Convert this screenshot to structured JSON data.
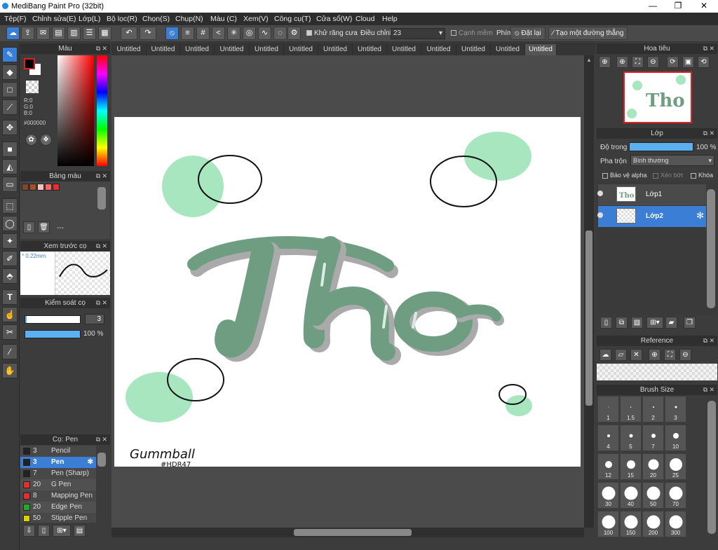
{
  "window": {
    "title": "MediBang Paint Pro (32bit)",
    "minimize": "—",
    "maximize": "❐",
    "close": "✕"
  },
  "menu": [
    "Tệp(F)",
    "Chỉnh sửa(E)",
    "Lớp(L)",
    "Bộ lọc(R)",
    "Chọn(S)",
    "Chụp(N)",
    "Màu (C)",
    "Xem(V)",
    "Công cụ(T)",
    "Cửa sổ(W)",
    "Cloud",
    "Help"
  ],
  "toolbar": {
    "antialias": "Khử răng cưa",
    "correction_label": "Điều chỉnh",
    "correction_value": "23",
    "soft_edge": "Cạnh mềm",
    "key_label": "Phím",
    "reset": "Đặt lại",
    "make_line": "Tạo một đường thẳng"
  },
  "tabs": [
    "Untitled",
    "Untitled",
    "Untitled",
    "Untitled",
    "Untitled",
    "Untitled",
    "Untitled",
    "Untitled",
    "Untitled",
    "Untitled",
    "Untitled",
    "Untitled",
    "Untitled"
  ],
  "color_panel": {
    "title": "Màu",
    "r": "R:0",
    "g": "G:0",
    "b": "B:0",
    "hex": "#000000"
  },
  "palette_panel": {
    "title": "Bảng màu",
    "dash": "---",
    "colors": [
      "#7a4a2a",
      "#a0522d",
      "#f4c2c2",
      "#ff6666",
      "#e03030"
    ]
  },
  "brush_preview": {
    "title": "Xem trước cọ",
    "size": "* 0.22mm"
  },
  "brush_control": {
    "title": "Kiểm soát cọ",
    "size_value": "3",
    "opacity_value": "100 %",
    "size_fill": 0.02,
    "opacity_fill": 1.0
  },
  "brush_list": {
    "title": "Cọ: Pen",
    "items": [
      {
        "size": "3",
        "name": "Pencil",
        "color": "#222222"
      },
      {
        "size": "3",
        "name": "Pen",
        "color": "#222222",
        "active": true
      },
      {
        "size": "7",
        "name": "Pen (Sharp)",
        "color": "#222222"
      },
      {
        "size": "20",
        "name": "G Pen",
        "color": "#e03030"
      },
      {
        "size": "8",
        "name": "Mapping Pen",
        "color": "#e03030"
      },
      {
        "size": "20",
        "name": "Edge Pen",
        "color": "#22aa22"
      },
      {
        "size": "50",
        "name": "Stipple Pen",
        "color": "#e0d000"
      }
    ]
  },
  "navigator": {
    "title": "Hoa tiêu"
  },
  "layer_panel": {
    "title": "Lớp",
    "opacity_label": "Độ trong",
    "opacity_value": "100 %",
    "opacity_fill": 1.0,
    "blend_label": "Pha trộn",
    "blend_value": "Bình thường",
    "protect_alpha": "Bảo vệ alpha",
    "clipping": "Xén bớt",
    "lock": "Khóa",
    "layers": [
      {
        "name": "Lớp1",
        "active": false
      },
      {
        "name": "Lớp2",
        "active": true
      }
    ]
  },
  "reference_panel": {
    "title": "Reference"
  },
  "brush_size_panel": {
    "title": "Brush Size",
    "sizes": [
      {
        "label": "1",
        "d": 1
      },
      {
        "label": "1.5",
        "d": 1.5
      },
      {
        "label": "2",
        "d": 2
      },
      {
        "label": "3",
        "d": 3
      },
      {
        "label": "4",
        "d": 4
      },
      {
        "label": "5",
        "d": 5
      },
      {
        "label": "7",
        "d": 6
      },
      {
        "label": "10",
        "d": 8
      },
      {
        "label": "12",
        "d": 10
      },
      {
        "label": "15",
        "d": 12
      },
      {
        "label": "20",
        "d": 15
      },
      {
        "label": "25",
        "d": 18
      },
      {
        "label": "30",
        "d": 19
      },
      {
        "label": "40",
        "d": 19
      },
      {
        "label": "50",
        "d": 19
      },
      {
        "label": "70",
        "d": 19
      },
      {
        "label": "100",
        "d": 19
      },
      {
        "label": "150",
        "d": 19
      },
      {
        "label": "200",
        "d": 19
      },
      {
        "label": "300",
        "d": 19
      }
    ]
  },
  "artwork": {
    "signature": "Gummball",
    "tag": "#HDR47",
    "mint": "#a8e6bf",
    "pen_green": "#6f9d82"
  }
}
